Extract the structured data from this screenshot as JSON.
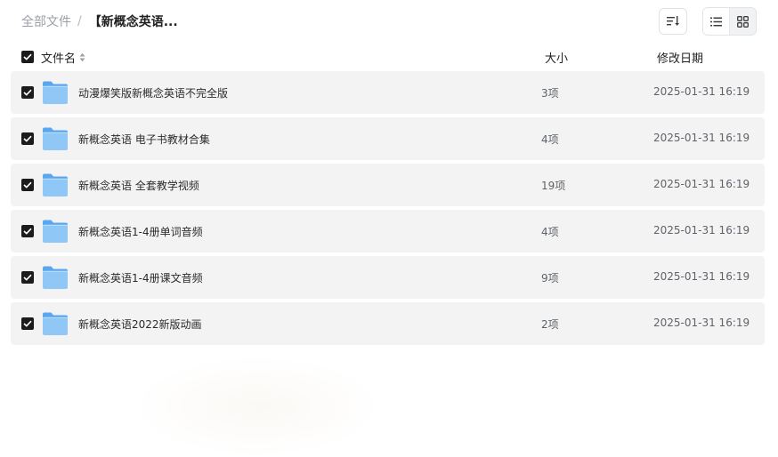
{
  "breadcrumb": {
    "root": "全部文件",
    "separator": "/",
    "current": "【新概念英语..."
  },
  "toolbar": {
    "sort_icon": "sort-icon",
    "list_view_icon": "list-view-icon",
    "grid_view_icon": "grid-view-icon"
  },
  "header": {
    "name": "文件名",
    "size": "大小",
    "date": "修改日期"
  },
  "files": [
    {
      "name": "动漫爆笑版新概念英语不完全版",
      "count": "3项",
      "date": "2025-01-31 16:19"
    },
    {
      "name": "新概念英语 电子书教材合集",
      "count": "4项",
      "date": "2025-01-31 16:19"
    },
    {
      "name": "新概念英语 全套教学视频",
      "count": "19项",
      "date": "2025-01-31 16:19"
    },
    {
      "name": "新概念英语1-4册单词音频",
      "count": "4项",
      "date": "2025-01-31 16:19"
    },
    {
      "name": "新概念英语1-4册课文音频",
      "count": "9项",
      "date": "2025-01-31 16:19"
    },
    {
      "name": "新概念英语2022新版动画",
      "count": "2项",
      "date": "2025-01-31 16:19"
    }
  ],
  "colors": {
    "row_bg": "#f3f3f4",
    "checkbox": "#1c1c1e",
    "folder_light": "#8fc7f7",
    "folder_dark": "#5aa7ef"
  }
}
